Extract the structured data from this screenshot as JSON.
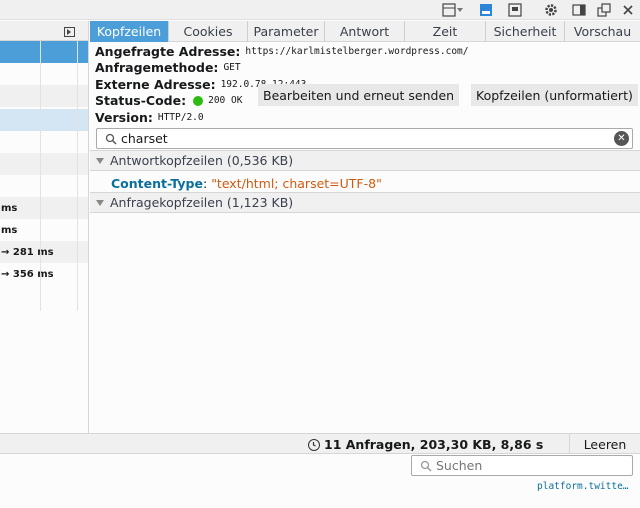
{
  "toolbar": {
    "icons": [
      "responsive-icon",
      "screenshot-icon",
      "frame-icon",
      "gear-icon",
      "dock-side-icon",
      "undock-icon",
      "close-icon"
    ]
  },
  "tabs": [
    "Kopfzeilen",
    "Cookies",
    "Parameter",
    "Antwort",
    "Zeit",
    "Sicherheit",
    "Vorschau"
  ],
  "summary": {
    "url_label": "Angefragte Adresse:",
    "url": "https://karlmistelberger.wordpress.com/",
    "method_label": "Anfragemethode:",
    "method": "GET",
    "remote_label": "Externe Adresse:",
    "remote": "192.0.78.12:443",
    "status_label": "Status-Code:",
    "status": "200 OK",
    "version_label": "Version:",
    "version": "HTTP/2.0",
    "edit_resend": "Bearbeiten und erneut senden",
    "raw_headers": "Kopfzeilen (unformatiert)"
  },
  "filter": {
    "value": "charset"
  },
  "response_headers": {
    "title": "Antwortkopfzeilen (0,536 KB)",
    "items": [
      {
        "name": "Content-Type",
        "value": "\"text/html; charset=UTF-8\""
      }
    ]
  },
  "request_headers": {
    "title": "Anfragekopfzeilen (1,123 KB)"
  },
  "request_list": {
    "rows": [
      "",
      "",
      "",
      "",
      "",
      "",
      "",
      "",
      "ms",
      "ms",
      "→ 281 ms",
      "→ 356 ms"
    ]
  },
  "footer": {
    "stats": "11 Anfragen, 203,30 KB, 8,86 s",
    "clear": "Leeren",
    "search_placeholder": "Suchen",
    "link": "platform.twitte…"
  },
  "colors": {
    "accent": "#4c9ed9",
    "status_ok": "#2cbb0f",
    "header_name": "#0b6f9e",
    "header_value": "#d05a0f"
  }
}
